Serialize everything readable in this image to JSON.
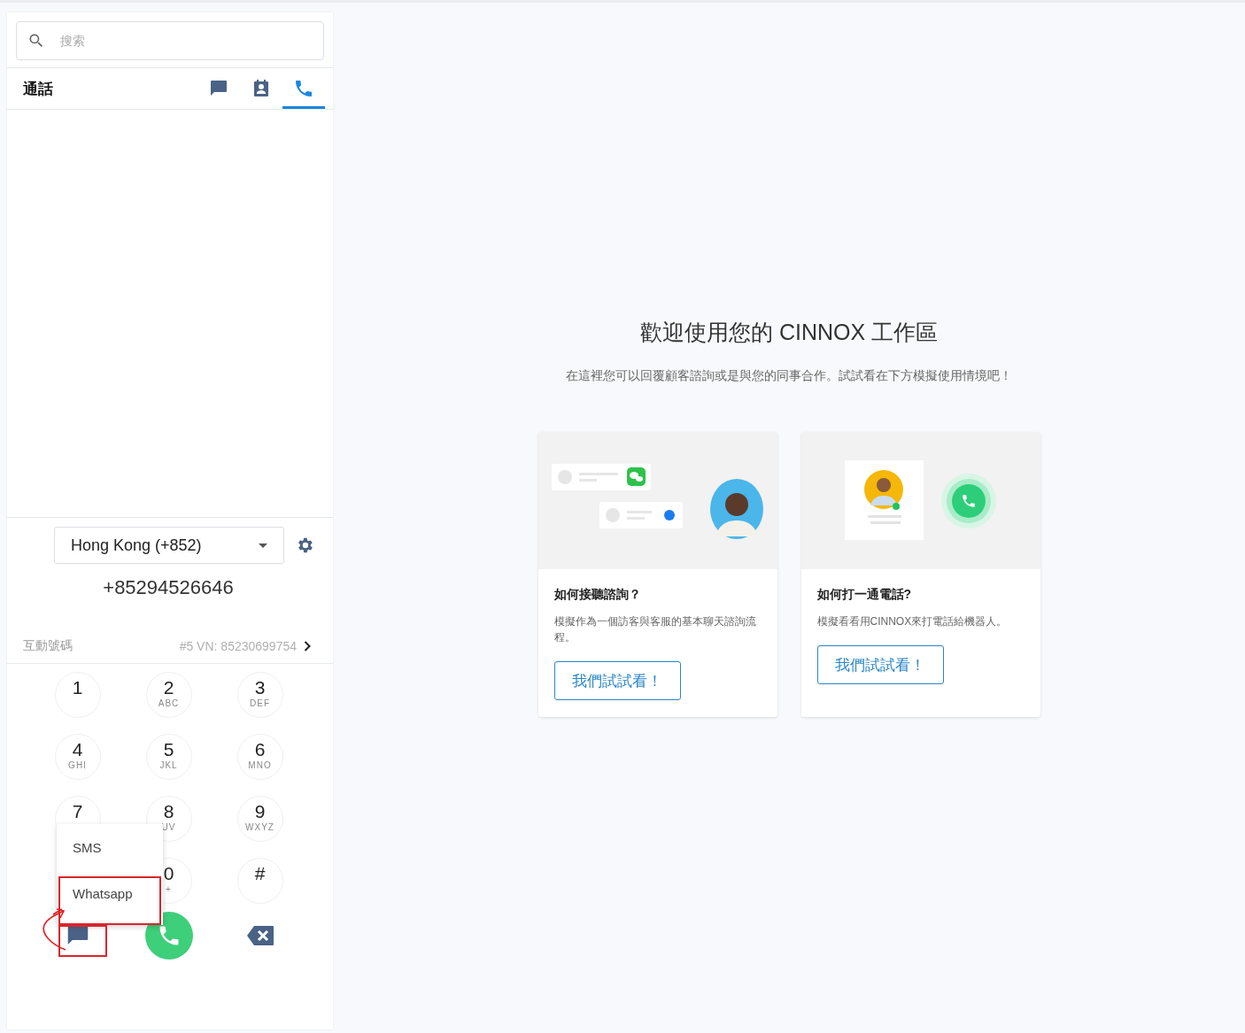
{
  "search": {
    "placeholder": "搜索"
  },
  "header": {
    "title": "通話",
    "tabs": [
      {
        "kind": "chat",
        "selected": false
      },
      {
        "kind": "contacts",
        "selected": false
      },
      {
        "kind": "call",
        "selected": true
      }
    ]
  },
  "dialer": {
    "country": "Hong Kong (+852)",
    "number": "+85294526646",
    "interactive_label": "互動號碼",
    "interactive_value": "#5 VN: 85230699754",
    "keys": [
      {
        "digit": "1"
      },
      {
        "digit": "2",
        "letters": "ABC"
      },
      {
        "digit": "3",
        "letters": "DEF"
      },
      {
        "digit": "4",
        "letters": "GHI"
      },
      {
        "digit": "5",
        "letters": "JKL"
      },
      {
        "digit": "6",
        "letters": "MNO"
      },
      {
        "digit": "7"
      },
      {
        "digit": "8",
        "letters": "UV"
      },
      {
        "digit": "9",
        "letters": "WXYZ"
      },
      {
        "digit": "0",
        "letters": "+"
      },
      {
        "digit": "#"
      }
    ],
    "menu": [
      "SMS",
      "Whatsapp"
    ]
  },
  "welcome": {
    "title": "歡迎使用您的 CINNOX 工作區",
    "subtitle": "在這裡您可以回覆顧客諮詢或是與您的同事合作。試試看在下方模擬使用情境吧！",
    "cards": [
      {
        "kind": "chat",
        "title": "如何接聽諮詢？",
        "text": "模擬作為一個訪客與客服的基本聊天諮詢流程。",
        "button": "我們試試看！"
      },
      {
        "kind": "call",
        "title": "如何打一通電話?",
        "text": "模擬看看用CINNOX來打電話給機器人。",
        "button": "我們試試看！"
      }
    ]
  }
}
